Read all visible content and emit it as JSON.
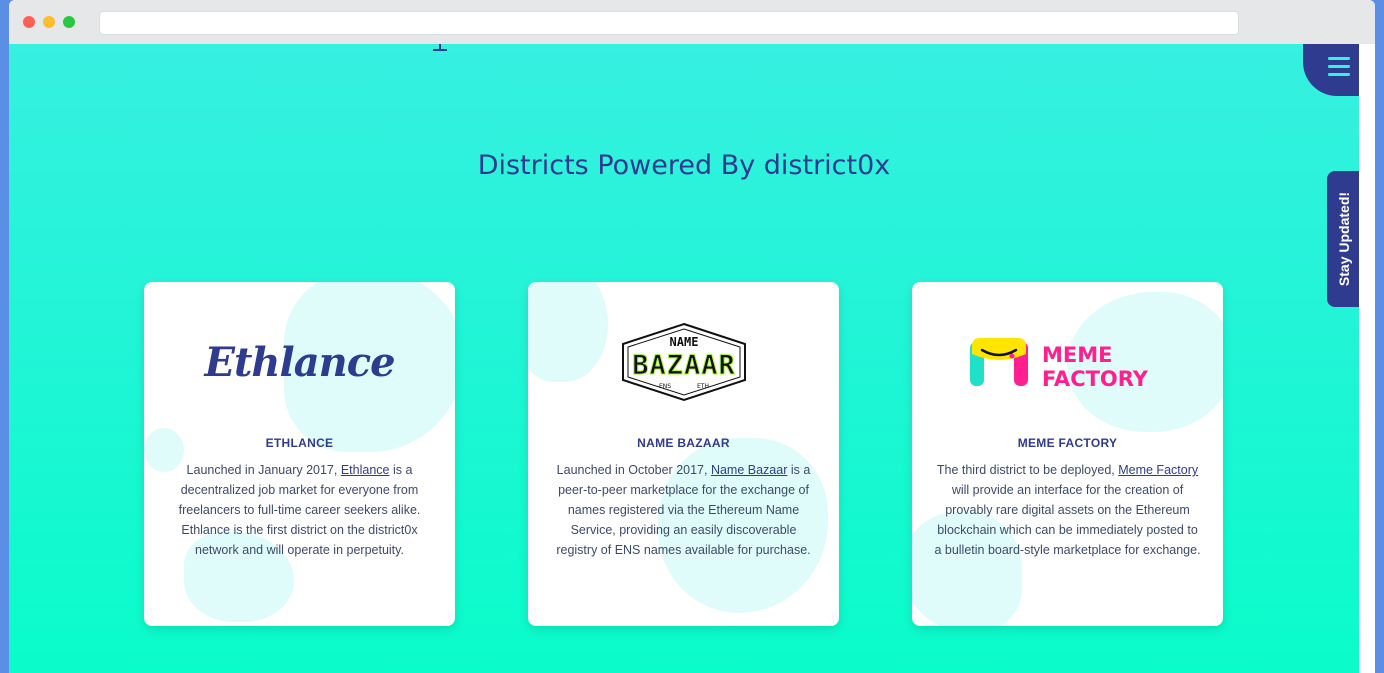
{
  "browser": {
    "url": ""
  },
  "header": {
    "menu_icon": "hamburger-menu-icon",
    "stay_updated_label": "Stay Updated!"
  },
  "section": {
    "title": "Districts Powered By district0x"
  },
  "cards": [
    {
      "logo_text": "Ethlance",
      "title": "ETHLANCE",
      "desc_before": "Launched in January 2017, ",
      "link_text": "Ethlance",
      "desc_after": " is a decentralized job market for everyone from freelancers to full-time career seekers alike. Ethlance is the first district on the district0x network and will operate in perpetuity."
    },
    {
      "logo_top": "NAME",
      "logo_main": "BAZAAR",
      "logo_sub_left": "ENS",
      "logo_sub_right": "ETH",
      "title": "NAME BAZAAR",
      "desc_before": "Launched in October 2017, ",
      "link_text": "Name Bazaar",
      "desc_after": " is a peer-to-peer marketplace for the exchange of names registered via the Ethereum Name Service, providing an easily discoverable registry of ENS names available for purchase."
    },
    {
      "logo_line1": "MEME",
      "logo_line2": "FACTORY",
      "title": "MEME FACTORY",
      "desc_before": "The third district to be deployed, ",
      "link_text": "Meme Factory",
      "desc_after": " will provide an interface for the creation of provably rare digital assets on the Ethereum blockchain which can be immediately posted to a bulletin board-style marketplace for exchange."
    }
  ],
  "colors": {
    "navy": "#2f3b8f",
    "aqua": "#36f0e0",
    "meme_pink": "#ff1f8e",
    "meme_yellow": "#ffe500",
    "meme_teal": "#1fe0c8"
  }
}
